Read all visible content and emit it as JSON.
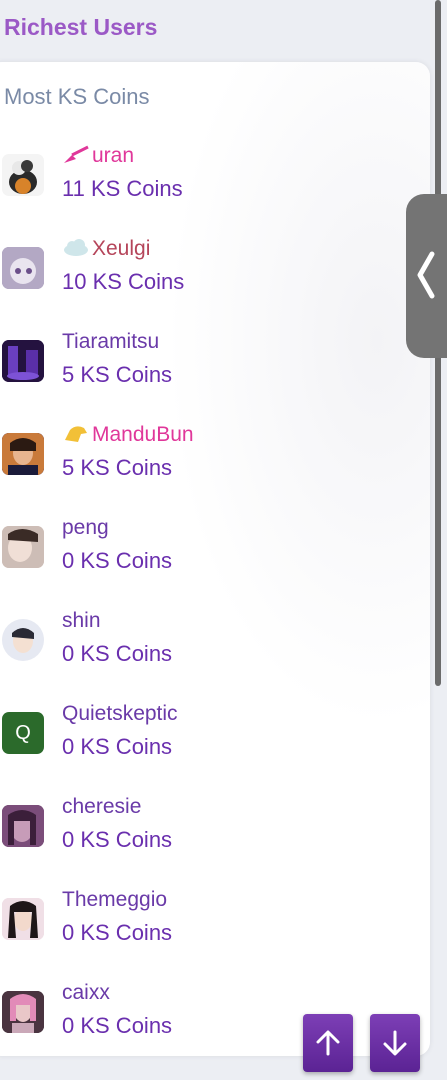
{
  "header": {
    "title": "Richest Users"
  },
  "card": {
    "title": "Most KS Coins"
  },
  "users": [
    {
      "name": "uran",
      "coins": "11 KS Coins",
      "badge": "broom-icon",
      "name_color": "#e0379a"
    },
    {
      "name": "Xeulgi",
      "coins": "10 KS Coins",
      "badge": "cloud-icon",
      "name_color": "#b5455a"
    },
    {
      "name": "Tiaramitsu",
      "coins": "5 KS Coins"
    },
    {
      "name": "ManduBun",
      "coins": "5 KS Coins",
      "badge": "horse-icon",
      "name_color": "#e0379a"
    },
    {
      "name": "peng",
      "coins": "0 KS Coins"
    },
    {
      "name": "shin",
      "coins": "0 KS Coins"
    },
    {
      "name": "Quietskeptic",
      "coins": "0 KS Coins",
      "avatar_letter": "Q"
    },
    {
      "name": "cheresie",
      "coins": "0 KS Coins"
    },
    {
      "name": "Themeggio",
      "coins": "0 KS Coins"
    },
    {
      "name": "caixx",
      "coins": "0 KS Coins"
    }
  ],
  "icons": {
    "side_tab": "chevron-left-icon",
    "scroll_up": "arrow-up-icon",
    "scroll_down": "arrow-down-icon"
  }
}
